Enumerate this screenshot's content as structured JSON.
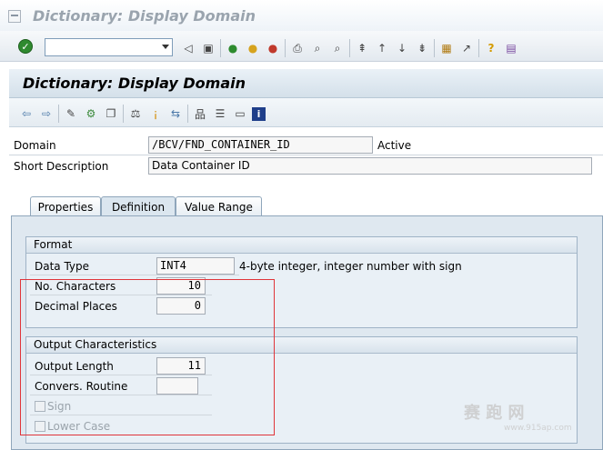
{
  "window": {
    "title": "Dictionary: Display Domain"
  },
  "screen": {
    "title": "Dictionary: Display Domain"
  },
  "toolbar": {
    "command_value": "",
    "icons": [
      "check-icon",
      "back-arrow-icon",
      "save-icon",
      "green-back-icon",
      "exit-icon",
      "cancel-icon",
      "print-icon",
      "find-icon",
      "find-next-icon",
      "first-page-icon",
      "prev-page-icon",
      "next-page-icon",
      "last-page-icon",
      "new-session-icon",
      "shortcut-icon",
      "help-icon",
      "layout-icon"
    ]
  },
  "app_toolbar": {
    "icons": [
      "back-icon",
      "forward-icon",
      "change-icon",
      "display-change-icon",
      "other-object-icon",
      "check-object-icon",
      "activate-icon",
      "where-used-icon",
      "hierarchy-icon",
      "print-list-icon",
      "documentation-icon",
      "info-icon"
    ]
  },
  "header": {
    "domain_label": "Domain",
    "domain_value": "/BCV/FND_CONTAINER_ID",
    "status": "Active",
    "short_desc_label": "Short Description",
    "short_desc_value": "Data Container ID"
  },
  "tabs": [
    {
      "label": "Properties",
      "active": false
    },
    {
      "label": "Definition",
      "active": true
    },
    {
      "label": "Value Range",
      "active": false
    }
  ],
  "format": {
    "title": "Format",
    "data_type_label": "Data Type",
    "data_type_value": "INT4",
    "data_type_desc": "4-byte integer, integer number with sign",
    "no_chars_label": "No. Characters",
    "no_chars_value": "10",
    "decimal_label": "Decimal Places",
    "decimal_value": "0"
  },
  "output": {
    "title": "Output Characteristics",
    "output_length_label": "Output Length",
    "output_length_value": "11",
    "conv_routine_label": "Convers. Routine",
    "conv_routine_value": "",
    "sign_label": "Sign",
    "lower_case_label": "Lower Case"
  },
  "watermark": {
    "text": "赛 跑 网",
    "url": "www.915ap.com"
  }
}
